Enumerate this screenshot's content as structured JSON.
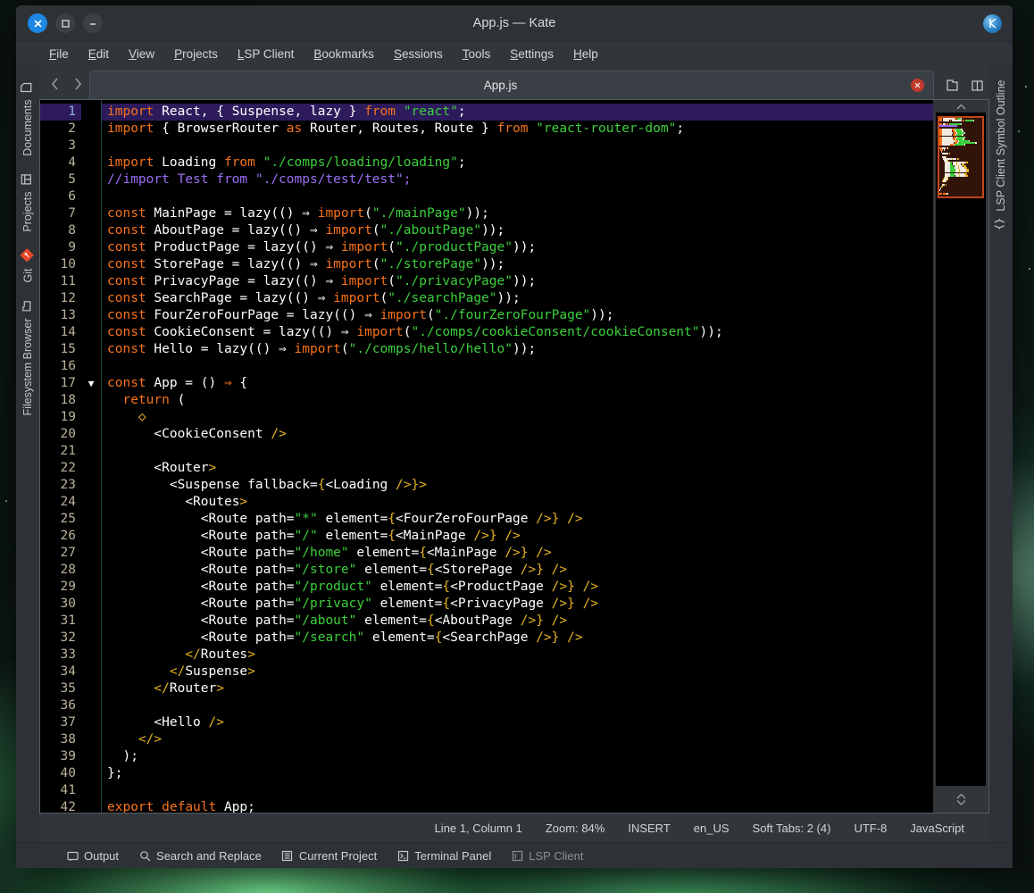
{
  "window": {
    "title": "App.js — Kate",
    "controls": {
      "close": "✕",
      "maximize": "❐",
      "minimize": "—"
    },
    "logo_icon": "kate-logo-icon"
  },
  "menubar": [
    {
      "label": "File",
      "accel": "F"
    },
    {
      "label": "Edit",
      "accel": "E"
    },
    {
      "label": "View",
      "accel": "V"
    },
    {
      "label": "Projects",
      "accel": "P"
    },
    {
      "label": "LSP Client",
      "accel": "L"
    },
    {
      "label": "Bookmarks",
      "accel": "B"
    },
    {
      "label": "Sessions",
      "accel": "S"
    },
    {
      "label": "Tools",
      "accel": "T"
    },
    {
      "label": "Settings",
      "accel": "S"
    },
    {
      "label": "Help",
      "accel": "H"
    }
  ],
  "left_sidebar": {
    "items": [
      {
        "label": "Documents",
        "icon": "document-icon"
      },
      {
        "label": "Projects",
        "icon": "projects-grid-icon"
      },
      {
        "label": "Git",
        "icon": "git-diamond-icon"
      },
      {
        "label": "Filesystem Browser",
        "icon": "folder-icon"
      }
    ]
  },
  "right_sidebar": {
    "items": [
      {
        "label": "LSP Client Symbol Outline",
        "icon": "braces-icon"
      }
    ]
  },
  "tabbar": {
    "prev_icon": "chevron-left-icon",
    "next_icon": "chevron-right-icon",
    "tab_label": "App.js",
    "close_icon": "close-circle-icon",
    "buttons": [
      {
        "name": "new-document-button",
        "icon": "document-add-icon"
      },
      {
        "name": "split-view-button",
        "icon": "split-view-icon"
      }
    ]
  },
  "statusbar": {
    "cursor": "Line 1, Column 1",
    "zoom": "Zoom: 84%",
    "mode": "INSERT",
    "locale": "en_US",
    "tabs": "Soft Tabs: 2 (4)",
    "encoding": "UTF-8",
    "language": "JavaScript"
  },
  "bottombar": [
    {
      "label": "Output",
      "icon": "output-icon",
      "dim": false
    },
    {
      "label": "Search and Replace",
      "icon": "search-icon",
      "dim": false
    },
    {
      "label": "Current Project",
      "icon": "project-icon",
      "dim": false
    },
    {
      "label": "Terminal Panel",
      "icon": "terminal-icon",
      "dim": false
    },
    {
      "label": "LSP Client",
      "icon": "lsp-icon",
      "dim": true
    }
  ],
  "editor": {
    "current_line": 1,
    "fold_marker_line": 17,
    "total_visible_lines": 43,
    "colors": {
      "background": "#000000",
      "keyword": "#f7721b",
      "string": "#3cd03c",
      "comment": "#9b6ef3",
      "jsx_tag": "#e6b422",
      "text": "#ffffff",
      "current_line_bg": "#2d1b5c",
      "line_number": "#b9b19a"
    },
    "lines": [
      [
        {
          "t": "import",
          "c": "kw"
        },
        {
          "t": " React, { Suspense, lazy } ",
          "c": "id"
        },
        {
          "t": "from",
          "c": "kw"
        },
        {
          "t": " ",
          "c": "id"
        },
        {
          "t": "\"react\"",
          "c": "str"
        },
        {
          "t": ";",
          "c": "id"
        }
      ],
      [
        {
          "t": "import",
          "c": "kw"
        },
        {
          "t": " { BrowserRouter ",
          "c": "id"
        },
        {
          "t": "as",
          "c": "kw"
        },
        {
          "t": " Router, Routes, Route } ",
          "c": "id"
        },
        {
          "t": "from",
          "c": "kw"
        },
        {
          "t": " ",
          "c": "id"
        },
        {
          "t": "\"react-router-dom\"",
          "c": "str"
        },
        {
          "t": ";",
          "c": "id"
        }
      ],
      [],
      [
        {
          "t": "import",
          "c": "kw"
        },
        {
          "t": " Loading ",
          "c": "id"
        },
        {
          "t": "from",
          "c": "kw"
        },
        {
          "t": " ",
          "c": "id"
        },
        {
          "t": "\"./comps/loading/loading\"",
          "c": "str"
        },
        {
          "t": ";",
          "c": "id"
        }
      ],
      [
        {
          "t": "//import Test from \"./comps/test/test\";",
          "c": "cmt"
        }
      ],
      [],
      [
        {
          "t": "const",
          "c": "kw"
        },
        {
          "t": " MainPage = lazy(() ⇒ ",
          "c": "id"
        },
        {
          "t": "import",
          "c": "kw"
        },
        {
          "t": "(",
          "c": "id"
        },
        {
          "t": "\"./mainPage\"",
          "c": "str"
        },
        {
          "t": "));",
          "c": "id"
        }
      ],
      [
        {
          "t": "const",
          "c": "kw"
        },
        {
          "t": " AboutPage = lazy(() ⇒ ",
          "c": "id"
        },
        {
          "t": "import",
          "c": "kw"
        },
        {
          "t": "(",
          "c": "id"
        },
        {
          "t": "\"./aboutPage\"",
          "c": "str"
        },
        {
          "t": "));",
          "c": "id"
        }
      ],
      [
        {
          "t": "const",
          "c": "kw"
        },
        {
          "t": " ProductPage = lazy(() ⇒ ",
          "c": "id"
        },
        {
          "t": "import",
          "c": "kw"
        },
        {
          "t": "(",
          "c": "id"
        },
        {
          "t": "\"./productPage\"",
          "c": "str"
        },
        {
          "t": "));",
          "c": "id"
        }
      ],
      [
        {
          "t": "const",
          "c": "kw"
        },
        {
          "t": " StorePage = lazy(() ⇒ ",
          "c": "id"
        },
        {
          "t": "import",
          "c": "kw"
        },
        {
          "t": "(",
          "c": "id"
        },
        {
          "t": "\"./storePage\"",
          "c": "str"
        },
        {
          "t": "));",
          "c": "id"
        }
      ],
      [
        {
          "t": "const",
          "c": "kw"
        },
        {
          "t": " PrivacyPage = lazy(() ⇒ ",
          "c": "id"
        },
        {
          "t": "import",
          "c": "kw"
        },
        {
          "t": "(",
          "c": "id"
        },
        {
          "t": "\"./privacyPage\"",
          "c": "str"
        },
        {
          "t": "));",
          "c": "id"
        }
      ],
      [
        {
          "t": "const",
          "c": "kw"
        },
        {
          "t": " SearchPage = lazy(() ⇒ ",
          "c": "id"
        },
        {
          "t": "import",
          "c": "kw"
        },
        {
          "t": "(",
          "c": "id"
        },
        {
          "t": "\"./searchPage\"",
          "c": "str"
        },
        {
          "t": "));",
          "c": "id"
        }
      ],
      [
        {
          "t": "const",
          "c": "kw"
        },
        {
          "t": " FourZeroFourPage = lazy(() ⇒ ",
          "c": "id"
        },
        {
          "t": "import",
          "c": "kw"
        },
        {
          "t": "(",
          "c": "id"
        },
        {
          "t": "\"./fourZeroFourPage\"",
          "c": "str"
        },
        {
          "t": "));",
          "c": "id"
        }
      ],
      [
        {
          "t": "const",
          "c": "kw"
        },
        {
          "t": " CookieConsent = lazy(() ⇒ ",
          "c": "id"
        },
        {
          "t": "import",
          "c": "kw"
        },
        {
          "t": "(",
          "c": "id"
        },
        {
          "t": "\"./comps/cookieConsent/cookieConsent\"",
          "c": "str"
        },
        {
          "t": "));",
          "c": "id"
        }
      ],
      [
        {
          "t": "const",
          "c": "kw"
        },
        {
          "t": " Hello = lazy(() ⇒ ",
          "c": "id"
        },
        {
          "t": "import",
          "c": "kw"
        },
        {
          "t": "(",
          "c": "id"
        },
        {
          "t": "\"./comps/hello/hello\"",
          "c": "str"
        },
        {
          "t": "));",
          "c": "id"
        }
      ],
      [],
      [
        {
          "t": "const",
          "c": "kw"
        },
        {
          "t": " App = () ",
          "c": "id"
        },
        {
          "t": "⇒",
          "c": "kw"
        },
        {
          "t": " {",
          "c": "id"
        }
      ],
      [
        {
          "t": "  ",
          "c": "id"
        },
        {
          "t": "return",
          "c": "kw"
        },
        {
          "t": " (",
          "c": "id"
        }
      ],
      [
        {
          "t": "    ",
          "c": "id"
        },
        {
          "t": "◇",
          "c": "tag"
        }
      ],
      [
        {
          "t": "      ",
          "c": "id"
        },
        {
          "t": "<CookieConsent",
          "c": "id"
        },
        {
          "t": " />",
          "c": "tag"
        }
      ],
      [],
      [
        {
          "t": "      ",
          "c": "id"
        },
        {
          "t": "<Router",
          "c": "id"
        },
        {
          "t": ">",
          "c": "tag"
        }
      ],
      [
        {
          "t": "        ",
          "c": "id"
        },
        {
          "t": "<Suspense fallback=",
          "c": "id"
        },
        {
          "t": "{",
          "c": "tag"
        },
        {
          "t": "<Loading",
          "c": "id"
        },
        {
          "t": " />}>",
          "c": "tag"
        }
      ],
      [
        {
          "t": "          ",
          "c": "id"
        },
        {
          "t": "<Routes",
          "c": "id"
        },
        {
          "t": ">",
          "c": "tag"
        }
      ],
      [
        {
          "t": "            ",
          "c": "id"
        },
        {
          "t": "<Route path=",
          "c": "id"
        },
        {
          "t": "\"*\"",
          "c": "str"
        },
        {
          "t": " element=",
          "c": "id"
        },
        {
          "t": "{",
          "c": "tag"
        },
        {
          "t": "<FourZeroFourPage",
          "c": "id"
        },
        {
          "t": " />} />",
          "c": "tag"
        }
      ],
      [
        {
          "t": "            ",
          "c": "id"
        },
        {
          "t": "<Route path=",
          "c": "id"
        },
        {
          "t": "\"/\"",
          "c": "str"
        },
        {
          "t": " element=",
          "c": "id"
        },
        {
          "t": "{",
          "c": "tag"
        },
        {
          "t": "<MainPage",
          "c": "id"
        },
        {
          "t": " />} />",
          "c": "tag"
        }
      ],
      [
        {
          "t": "            ",
          "c": "id"
        },
        {
          "t": "<Route path=",
          "c": "id"
        },
        {
          "t": "\"/home\"",
          "c": "str"
        },
        {
          "t": " element=",
          "c": "id"
        },
        {
          "t": "{",
          "c": "tag"
        },
        {
          "t": "<MainPage",
          "c": "id"
        },
        {
          "t": " />} />",
          "c": "tag"
        }
      ],
      [
        {
          "t": "            ",
          "c": "id"
        },
        {
          "t": "<Route path=",
          "c": "id"
        },
        {
          "t": "\"/store\"",
          "c": "str"
        },
        {
          "t": " element=",
          "c": "id"
        },
        {
          "t": "{",
          "c": "tag"
        },
        {
          "t": "<StorePage",
          "c": "id"
        },
        {
          "t": " />} />",
          "c": "tag"
        }
      ],
      [
        {
          "t": "            ",
          "c": "id"
        },
        {
          "t": "<Route path=",
          "c": "id"
        },
        {
          "t": "\"/product\"",
          "c": "str"
        },
        {
          "t": " element=",
          "c": "id"
        },
        {
          "t": "{",
          "c": "tag"
        },
        {
          "t": "<ProductPage",
          "c": "id"
        },
        {
          "t": " />} />",
          "c": "tag"
        }
      ],
      [
        {
          "t": "            ",
          "c": "id"
        },
        {
          "t": "<Route path=",
          "c": "id"
        },
        {
          "t": "\"/privacy\"",
          "c": "str"
        },
        {
          "t": " element=",
          "c": "id"
        },
        {
          "t": "{",
          "c": "tag"
        },
        {
          "t": "<PrivacyPage",
          "c": "id"
        },
        {
          "t": " />} />",
          "c": "tag"
        }
      ],
      [
        {
          "t": "            ",
          "c": "id"
        },
        {
          "t": "<Route path=",
          "c": "id"
        },
        {
          "t": "\"/about\"",
          "c": "str"
        },
        {
          "t": " element=",
          "c": "id"
        },
        {
          "t": "{",
          "c": "tag"
        },
        {
          "t": "<AboutPage",
          "c": "id"
        },
        {
          "t": " />} />",
          "c": "tag"
        }
      ],
      [
        {
          "t": "            ",
          "c": "id"
        },
        {
          "t": "<Route path=",
          "c": "id"
        },
        {
          "t": "\"/search\"",
          "c": "str"
        },
        {
          "t": " element=",
          "c": "id"
        },
        {
          "t": "{",
          "c": "tag"
        },
        {
          "t": "<SearchPage",
          "c": "id"
        },
        {
          "t": " />} />",
          "c": "tag"
        }
      ],
      [
        {
          "t": "          ",
          "c": "id"
        },
        {
          "t": "</",
          "c": "tag"
        },
        {
          "t": "Routes",
          "c": "id"
        },
        {
          "t": ">",
          "c": "tag"
        }
      ],
      [
        {
          "t": "        ",
          "c": "id"
        },
        {
          "t": "</",
          "c": "tag"
        },
        {
          "t": "Suspense",
          "c": "id"
        },
        {
          "t": ">",
          "c": "tag"
        }
      ],
      [
        {
          "t": "      ",
          "c": "id"
        },
        {
          "t": "</",
          "c": "tag"
        },
        {
          "t": "Router",
          "c": "id"
        },
        {
          "t": ">",
          "c": "tag"
        }
      ],
      [],
      [
        {
          "t": "      ",
          "c": "id"
        },
        {
          "t": "<Hello",
          "c": "id"
        },
        {
          "t": " />",
          "c": "tag"
        }
      ],
      [
        {
          "t": "    ",
          "c": "id"
        },
        {
          "t": "</>",
          "c": "tag"
        }
      ],
      [
        {
          "t": "  );",
          "c": "id"
        }
      ],
      [
        {
          "t": "};",
          "c": "id"
        }
      ],
      [],
      [
        {
          "t": "export",
          "c": "kw"
        },
        {
          "t": " ",
          "c": "id"
        },
        {
          "t": "default",
          "c": "kw"
        },
        {
          "t": " App;",
          "c": "id"
        }
      ],
      []
    ]
  }
}
